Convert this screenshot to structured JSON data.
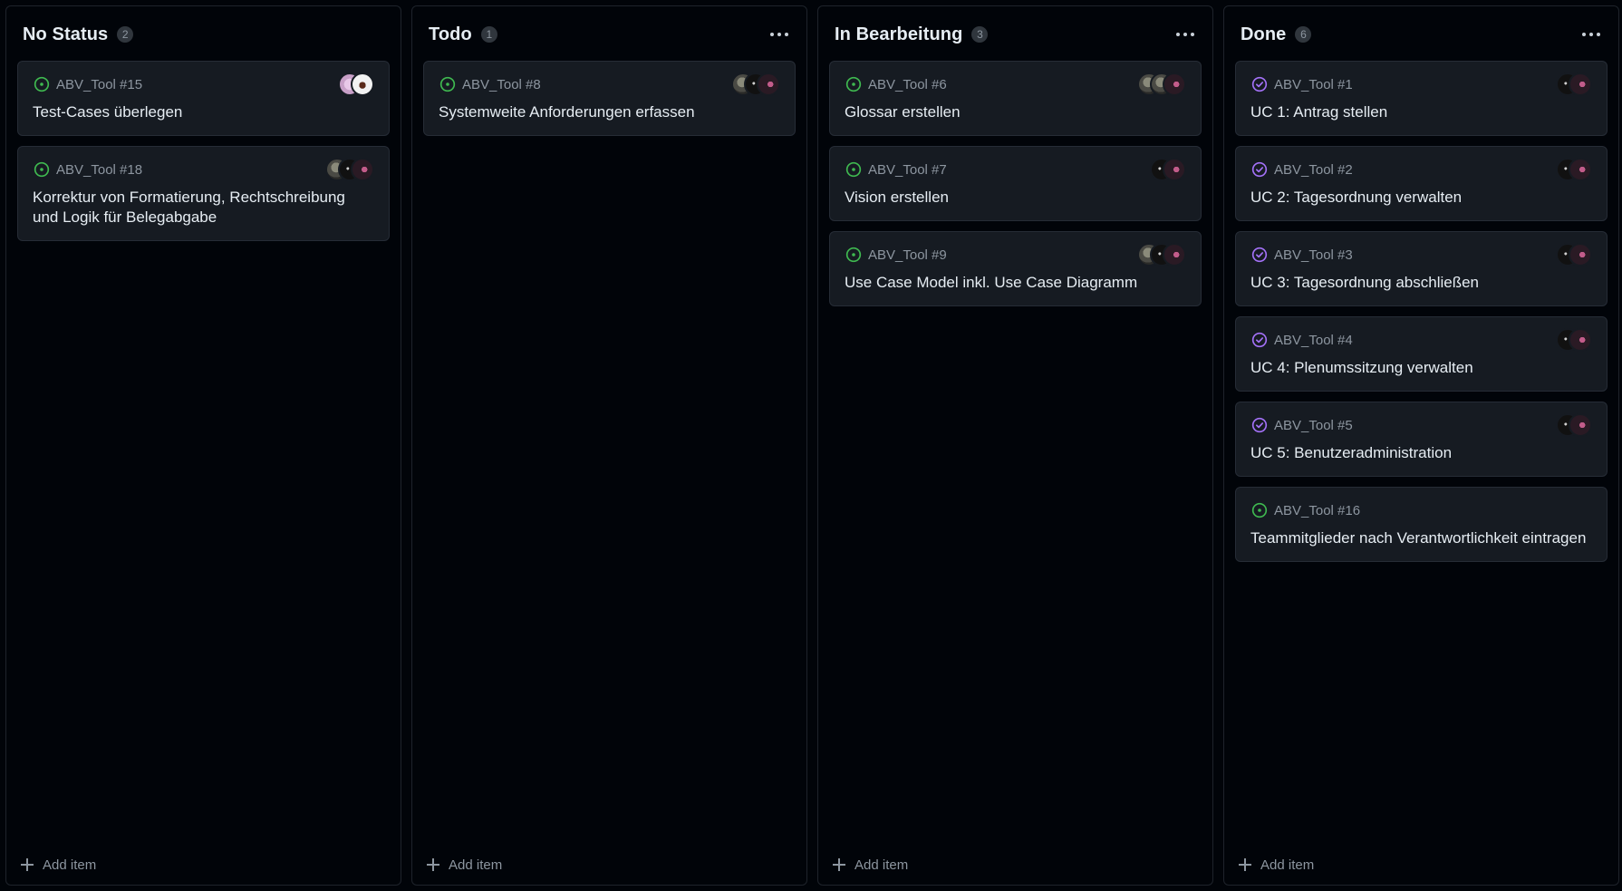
{
  "colors": {
    "open_issue": "#3fb950",
    "closed_issue": "#a371f7",
    "background": "#010409",
    "card": "#161b22"
  },
  "add_item_label": "Add item",
  "columns": [
    {
      "title": "No Status",
      "count": "2",
      "has_menu": false,
      "cards": [
        {
          "id": "ABV_Tool #15",
          "title": "Test-Cases überlegen",
          "status": "open",
          "avatars": [
            "av-lilac",
            "av-white"
          ]
        },
        {
          "id": "ABV_Tool #18",
          "title": "Korrektur von Formatierung, Rechtschreibung und Logik für Belegabgabe",
          "status": "open",
          "avatars": [
            "av-gray",
            "av-dark",
            "av-pink"
          ]
        }
      ]
    },
    {
      "title": "Todo",
      "count": "1",
      "has_menu": true,
      "cards": [
        {
          "id": "ABV_Tool #8",
          "title": "Systemweite Anforderungen erfassen",
          "status": "open",
          "avatars": [
            "av-gray",
            "av-dark",
            "av-pink"
          ]
        }
      ]
    },
    {
      "title": "In Bearbeitung",
      "count": "3",
      "has_menu": true,
      "cards": [
        {
          "id": "ABV_Tool #6",
          "title": "Glossar erstellen",
          "status": "open",
          "avatars": [
            "av-gray",
            "av-gray",
            "av-pink"
          ]
        },
        {
          "id": "ABV_Tool #7",
          "title": "Vision erstellen",
          "status": "open",
          "avatars": [
            "av-dark",
            "av-pink"
          ]
        },
        {
          "id": "ABV_Tool #9",
          "title": "Use Case Model inkl. Use Case Diagramm",
          "status": "open",
          "avatars": [
            "av-gray",
            "av-dark",
            "av-pink"
          ]
        }
      ]
    },
    {
      "title": "Done",
      "count": "6",
      "has_menu": true,
      "cards": [
        {
          "id": "ABV_Tool #1",
          "title": "UC 1: Antrag stellen",
          "status": "closed",
          "avatars": [
            "av-dark",
            "av-pink"
          ]
        },
        {
          "id": "ABV_Tool #2",
          "title": "UC 2: Tagesordnung verwalten",
          "status": "closed",
          "avatars": [
            "av-dark",
            "av-pink"
          ]
        },
        {
          "id": "ABV_Tool #3",
          "title": "UC 3: Tagesordnung abschließen",
          "status": "closed",
          "avatars": [
            "av-dark",
            "av-pink"
          ]
        },
        {
          "id": "ABV_Tool #4",
          "title": "UC 4: Plenumssitzung verwalten",
          "status": "closed",
          "avatars": [
            "av-dark",
            "av-pink"
          ]
        },
        {
          "id": "ABV_Tool #5",
          "title": "UC 5: Benutzeradministration",
          "status": "closed",
          "avatars": [
            "av-dark",
            "av-pink"
          ]
        },
        {
          "id": "ABV_Tool #16",
          "title": "Teammitglieder nach Verantwortlichkeit eintragen",
          "status": "open",
          "avatars": []
        }
      ]
    }
  ]
}
